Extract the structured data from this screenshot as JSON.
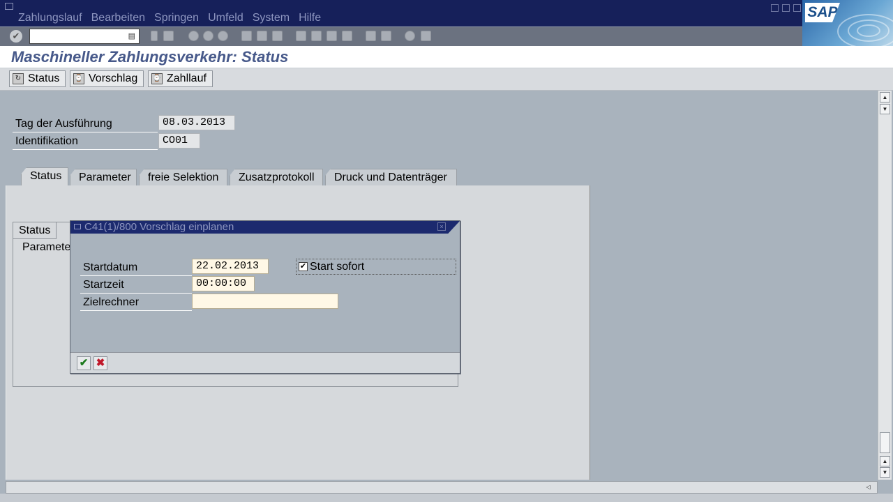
{
  "menubar": {
    "items": [
      "Zahlungslauf",
      "Bearbeiten",
      "Springen",
      "Umfeld",
      "System",
      "Hilfe"
    ],
    "logo_text": "SAP"
  },
  "toolbar": {
    "okcode_value": "",
    "icons": [
      "enter-icon",
      "back-icon",
      "save-icon",
      "back-nav-icon",
      "exit-icon",
      "cancel-icon",
      "print-icon",
      "find-icon",
      "find-next-icon",
      "first-page-icon",
      "prev-page-icon",
      "next-page-icon",
      "last-page-icon",
      "create-session-icon",
      "shortcut-icon",
      "help-icon",
      "layout-menu-icon"
    ]
  },
  "page": {
    "title": "Maschineller Zahlungsverkehr: Status"
  },
  "app_toolbar": {
    "status_label": "Status",
    "vorschlag_label": "Vorschlag",
    "zahllauf_label": "Zahllauf"
  },
  "header_fields": {
    "tag_label": "Tag der Ausführung",
    "tag_value": "08.03.2013",
    "ident_label": "Identifikation",
    "ident_value": "CO01"
  },
  "tabs": [
    "Status",
    "Parameter",
    "freie Selektion",
    "Zusatzprotokoll",
    "Druck und Datenträger"
  ],
  "status_group": {
    "title": "Status",
    "line1": "Parameter"
  },
  "dialog": {
    "title": "C41(1)/800 Vorschlag einplanen",
    "startdatum_label": "Startdatum",
    "startdatum_value": "22.02.2013",
    "startzeit_label": "Startzeit",
    "startzeit_value": "00:00:00",
    "zielrechner_label": "Zielrechner",
    "zielrechner_value": "",
    "start_sofort_label": "Start sofort",
    "start_sofort_checked": true
  },
  "colors": {
    "menubar_bg": "#16205a",
    "title_text": "#47598a",
    "workarea_bg": "#a9b3bd",
    "input_bg": "#fff8e6"
  }
}
